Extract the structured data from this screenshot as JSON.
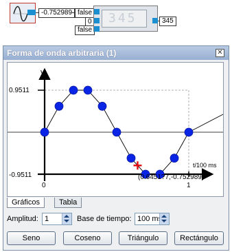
{
  "diagram": {
    "output_value": "-0.752989",
    "false_top": "false",
    "input_zero": "0",
    "false_bottom": "false",
    "display_digits": "345",
    "display_output": "345"
  },
  "window": {
    "title": "Forma de onda arbitraria (1)",
    "close_glyph": "✕"
  },
  "chart_data": {
    "type": "line",
    "y_axis_label": "y",
    "x_axis_label": "t/100 ms",
    "y_ticks": [
      "0.9511",
      "-0.9511"
    ],
    "x_ticks": [
      "0",
      "1"
    ],
    "cursor_readout": "(0.6451?7,-0.752989)",
    "xlim": [
      0,
      1
    ],
    "ylim": [
      -0.9511,
      0.9511
    ],
    "x": [
      0,
      0.1,
      0.2,
      0.3,
      0.4,
      0.5,
      0.6,
      0.7,
      0.8,
      0.9,
      1.0
    ],
    "values": [
      0,
      0.5878,
      0.9511,
      0.9511,
      0.5878,
      0,
      -0.5878,
      -0.9511,
      -0.9511,
      -0.5878,
      0
    ],
    "cursor": {
      "x": 0.6451,
      "y": -0.752989
    }
  },
  "tabs": [
    {
      "label": "Gráficos"
    },
    {
      "label": "Tabla"
    }
  ],
  "controls": {
    "amplitude_label": "Amplitud:",
    "amplitude_value": "1",
    "timebase_label": "Base de tiempo:",
    "timebase_value": "100 ms"
  },
  "buttons": {
    "sine": "Seno",
    "cosine": "Coseno",
    "triangle": "Triángulo",
    "rectangle": "Rectángulo"
  }
}
